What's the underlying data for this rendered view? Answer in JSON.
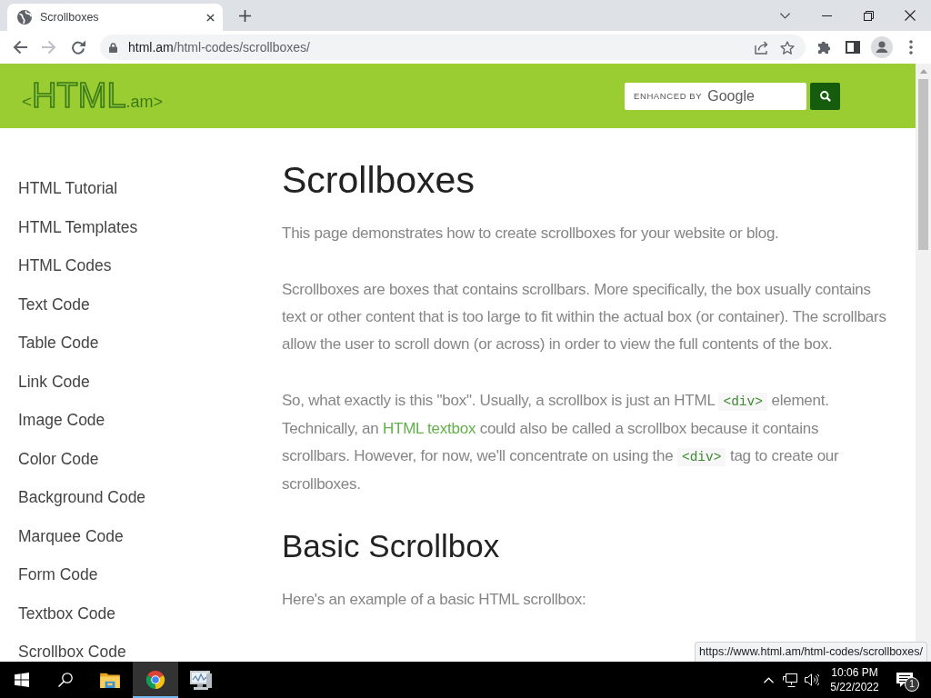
{
  "browser": {
    "tab": {
      "title": "Scrollboxes"
    },
    "nav": {
      "back_disabled": false,
      "forward_disabled": true
    },
    "address": {
      "host": "html.am",
      "path": "/html-codes/scrollboxes/"
    }
  },
  "header": {
    "logo": {
      "open": "<",
      "name": "HTML",
      "suffix": ".am>"
    },
    "search": {
      "hint_prefix": "ENHANCED BY",
      "hint_brand": "Google"
    }
  },
  "sidebar": {
    "items": [
      {
        "label": "HTML Tutorial"
      },
      {
        "label": "HTML Templates"
      },
      {
        "label": "HTML Codes"
      },
      {
        "label": "Text Code"
      },
      {
        "label": "Table Code"
      },
      {
        "label": "Link Code"
      },
      {
        "label": "Image Code"
      },
      {
        "label": "Color Code"
      },
      {
        "label": "Background Code"
      },
      {
        "label": "Marquee Code"
      },
      {
        "label": "Form Code"
      },
      {
        "label": "Textbox Code"
      },
      {
        "label": "Scrollbox Code"
      }
    ]
  },
  "article": {
    "title": "Scrollboxes",
    "blocks": [
      {
        "kind": "paragraph",
        "segments": [
          {
            "kind": "text",
            "text": "This page demonstrates how to create scrollboxes for your website or blog."
          }
        ]
      },
      {
        "kind": "paragraph",
        "segments": [
          {
            "kind": "text",
            "text": "Scrollboxes are boxes that contains scrollbars. More specifically, the box usually contains text or other content that is too large to fit within the actual box (or container). The scrollbars allow the user to scroll down (or across) in order to view the full contents of the box."
          }
        ]
      },
      {
        "kind": "paragraph",
        "segments": [
          {
            "kind": "text",
            "text": "So, what exactly is this \"box\". Usually, a scrollbox is just an HTML "
          },
          {
            "kind": "code",
            "text": "<div>"
          },
          {
            "kind": "text",
            "text": " element. Technically, an "
          },
          {
            "kind": "link",
            "text": "HTML textbox"
          },
          {
            "kind": "text",
            "text": " could also be called a scrollbox because it contains scrollbars. However, for now, we'll concentrate on using the "
          },
          {
            "kind": "code",
            "text": "<div>"
          },
          {
            "kind": "text",
            "text": " tag to create our scrollboxes."
          }
        ]
      },
      {
        "kind": "heading",
        "text": "Basic Scrollbox"
      },
      {
        "kind": "paragraph",
        "segments": [
          {
            "kind": "text",
            "text": "Here's an example of a basic HTML scrollbox:"
          }
        ]
      }
    ]
  },
  "status_bubble": {
    "url": "https://www.html.am/html-codes/scrollboxes/"
  },
  "taskbar": {
    "apps": [
      {
        "kind": "explorer",
        "selected": false
      },
      {
        "kind": "browser",
        "selected": true
      },
      {
        "kind": "monitor",
        "selected": false
      }
    ],
    "clock": {
      "time": "10:06 PM",
      "date": "5/22/2022"
    },
    "notifications": {
      "count": "1"
    }
  }
}
